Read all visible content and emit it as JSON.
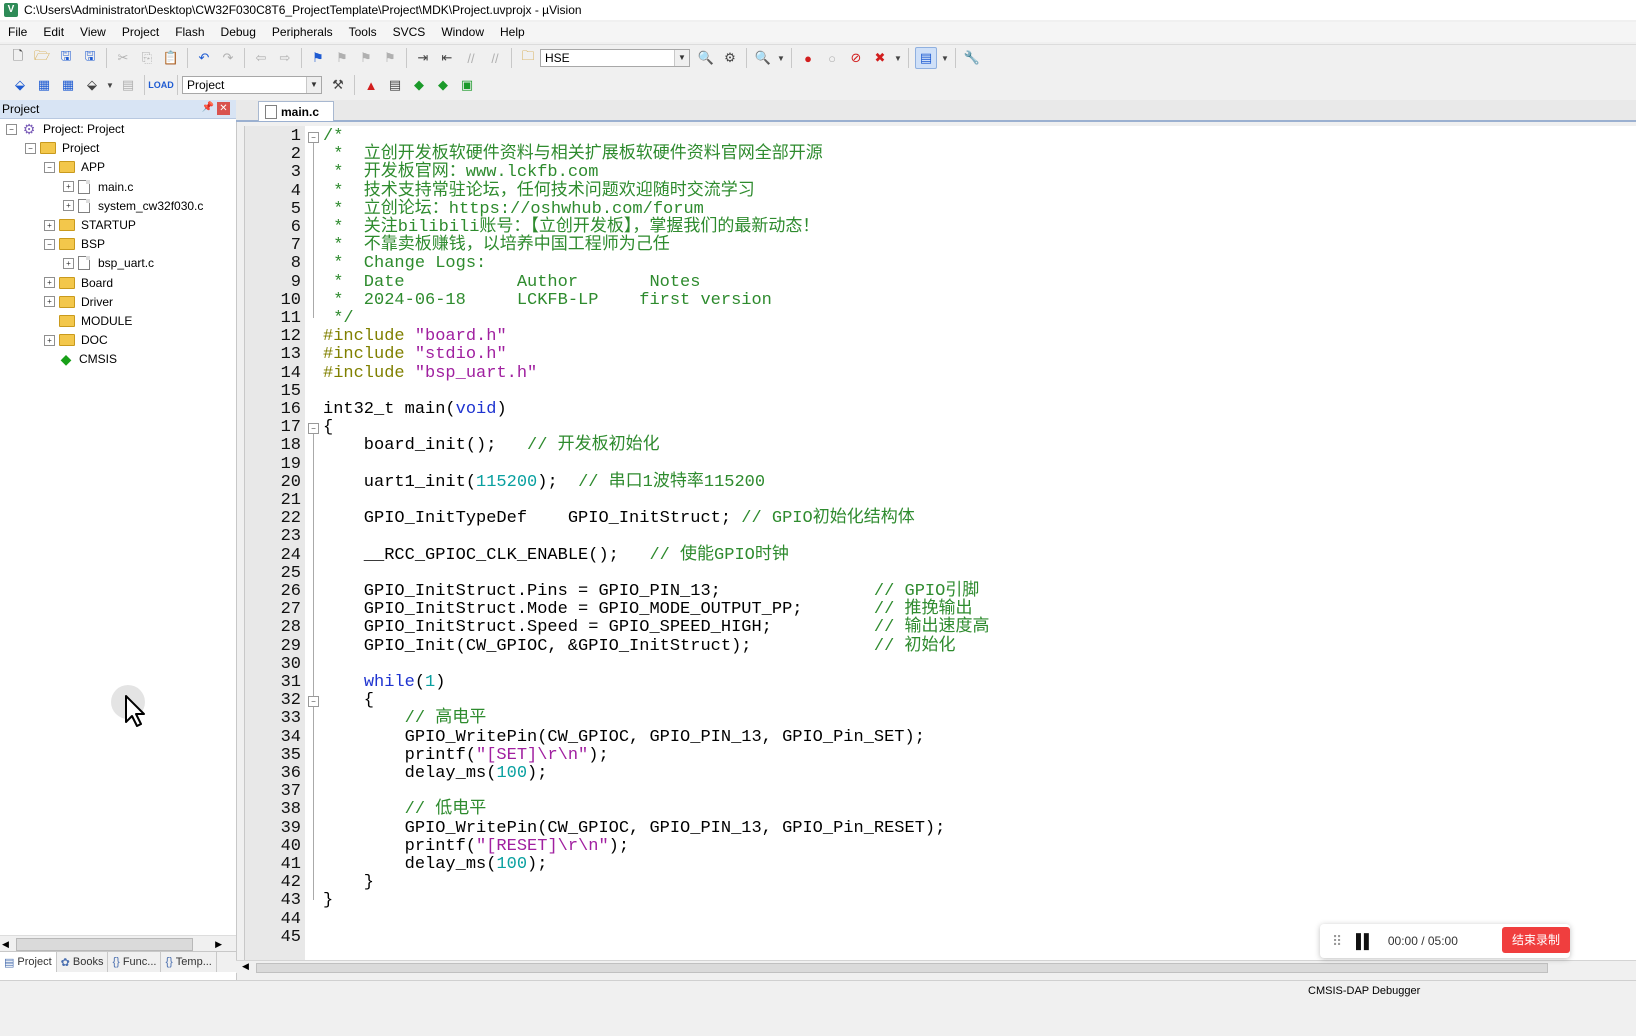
{
  "window": {
    "title": "C:\\Users\\Administrator\\Desktop\\CW32F030C8T6_ProjectTemplate\\Project\\MDK\\Project.uvprojx - µVision",
    "app_icon": "uvision-icon"
  },
  "menu": [
    "File",
    "Edit",
    "View",
    "Project",
    "Flash",
    "Debug",
    "Peripherals",
    "Tools",
    "SVCS",
    "Window",
    "Help"
  ],
  "toolbar1": {
    "search_combo": "HSE"
  },
  "toolbar2": {
    "target_combo": "Project"
  },
  "project_panel": {
    "header": "Project",
    "tree": [
      {
        "label": "Project: Project",
        "level": 0,
        "expander": "−",
        "icon": "project"
      },
      {
        "label": "Project",
        "level": 1,
        "expander": "−",
        "icon": "target"
      },
      {
        "label": "APP",
        "level": 2,
        "expander": "−",
        "icon": "folder"
      },
      {
        "label": "main.c",
        "level": 3,
        "expander": "+",
        "icon": "file"
      },
      {
        "label": "system_cw32f030.c",
        "level": 3,
        "expander": "+",
        "icon": "file"
      },
      {
        "label": "STARTUP",
        "level": 2,
        "expander": "+",
        "icon": "folder"
      },
      {
        "label": "BSP",
        "level": 2,
        "expander": "−",
        "icon": "folder"
      },
      {
        "label": "bsp_uart.c",
        "level": 3,
        "expander": "+",
        "icon": "file"
      },
      {
        "label": "Board",
        "level": 2,
        "expander": "+",
        "icon": "folder"
      },
      {
        "label": "Driver",
        "level": 2,
        "expander": "+",
        "icon": "folder"
      },
      {
        "label": "MODULE",
        "level": 2,
        "expander": "",
        "icon": "folder"
      },
      {
        "label": "DOC",
        "level": 2,
        "expander": "+",
        "icon": "folder"
      },
      {
        "label": "CMSIS",
        "level": 2,
        "expander": "",
        "icon": "diamond"
      }
    ],
    "bottom_tabs": [
      "Project",
      "Books",
      "Func...",
      "Temp..."
    ]
  },
  "editor": {
    "tab": "main.c",
    "lines": [
      [
        [
          "cm",
          "/*"
        ]
      ],
      [
        [
          "cm",
          " *  立创开发板软硬件资料与相关扩展板软硬件资料官网全部开源"
        ]
      ],
      [
        [
          "cm",
          " *  开发板官网：www.lckfb.com"
        ]
      ],
      [
        [
          "cm",
          " *  技术支持常驻论坛，任何技术问题欢迎随时交流学习"
        ]
      ],
      [
        [
          "cm",
          " *  立创论坛：https://oshwhub.com/forum"
        ]
      ],
      [
        [
          "cm",
          " *  关注bilibili账号：【立创开发板】，掌握我们的最新动态！"
        ]
      ],
      [
        [
          "cm",
          " *  不靠卖板赚钱，以培养中国工程师为己任"
        ]
      ],
      [
        [
          "cm",
          " *  Change Logs:"
        ]
      ],
      [
        [
          "cm",
          " *  Date           Author       Notes"
        ]
      ],
      [
        [
          "cm",
          " *  2024-06-18     LCKFB-LP    first version"
        ]
      ],
      [
        [
          "cm",
          " */"
        ]
      ],
      [
        [
          "pp",
          "#include "
        ],
        [
          "str",
          "\"board.h\""
        ]
      ],
      [
        [
          "pp",
          "#include "
        ],
        [
          "str",
          "\"stdio.h\""
        ]
      ],
      [
        [
          "pp",
          "#include "
        ],
        [
          "str",
          "\"bsp_uart.h\""
        ]
      ],
      [],
      [
        [
          "",
          "int32_t main("
        ],
        [
          "kw",
          "void"
        ],
        [
          "",
          ")"
        ]
      ],
      [
        [
          "",
          "{"
        ]
      ],
      [
        [
          "",
          "    board_init();   "
        ],
        [
          "cm",
          "// 开发板初始化"
        ]
      ],
      [],
      [
        [
          "",
          "    uart1_init("
        ],
        [
          "num",
          "115200"
        ],
        [
          "",
          ");  "
        ],
        [
          "cm",
          "// 串口1波特率115200"
        ]
      ],
      [],
      [
        [
          "",
          "    GPIO_InitTypeDef    GPIO_InitStruct; "
        ],
        [
          "cm",
          "// GPIO初始化结构体"
        ]
      ],
      [],
      [
        [
          "",
          "    __RCC_GPIOC_CLK_ENABLE();   "
        ],
        [
          "cm",
          "// 使能GPIO时钟"
        ]
      ],
      [],
      [
        [
          "",
          "    GPIO_InitStruct.Pins = GPIO_PIN_13;               "
        ],
        [
          "cm",
          "// GPIO引脚"
        ]
      ],
      [
        [
          "",
          "    GPIO_InitStruct.Mode = GPIO_MODE_OUTPUT_PP;       "
        ],
        [
          "cm",
          "// 推挽输出"
        ]
      ],
      [
        [
          "",
          "    GPIO_InitStruct.Speed = GPIO_SPEED_HIGH;          "
        ],
        [
          "cm",
          "// 输出速度高"
        ]
      ],
      [
        [
          "",
          "    GPIO_Init(CW_GPIOC, &GPIO_InitStruct);            "
        ],
        [
          "cm",
          "// 初始化"
        ]
      ],
      [],
      [
        [
          "",
          "    "
        ],
        [
          "kw",
          "while"
        ],
        [
          "",
          "("
        ],
        [
          "num",
          "1"
        ],
        [
          "",
          ")"
        ]
      ],
      [
        [
          "",
          "    {"
        ]
      ],
      [
        [
          "",
          "        "
        ],
        [
          "cm",
          "// 高电平"
        ]
      ],
      [
        [
          "",
          "        GPIO_WritePin(CW_GPIOC, GPIO_PIN_13, GPIO_Pin_SET);"
        ]
      ],
      [
        [
          "",
          "        printf("
        ],
        [
          "str",
          "\"[SET]\\r\\n\""
        ],
        [
          "",
          ");"
        ]
      ],
      [
        [
          "",
          "        delay_ms("
        ],
        [
          "num",
          "100"
        ],
        [
          "",
          ");"
        ]
      ],
      [],
      [
        [
          "",
          "        "
        ],
        [
          "cm",
          "// 低电平"
        ]
      ],
      [
        [
          "",
          "        GPIO_WritePin(CW_GPIOC, GPIO_PIN_13, GPIO_Pin_RESET);"
        ]
      ],
      [
        [
          "",
          "        printf("
        ],
        [
          "str",
          "\"[RESET]\\r\\n\""
        ],
        [
          "",
          ");"
        ]
      ],
      [
        [
          "",
          "        delay_ms("
        ],
        [
          "num",
          "100"
        ],
        [
          "",
          ");"
        ]
      ],
      [
        [
          "",
          "    }"
        ]
      ],
      [
        [
          "",
          "}"
        ]
      ],
      [],
      []
    ],
    "fold_markers": [
      1,
      17,
      32
    ]
  },
  "recorder": {
    "time": "00:00 / 05:00",
    "stop_label": "结束录制"
  },
  "statusbar": {
    "debugger": "CMSIS-DAP Debugger"
  }
}
